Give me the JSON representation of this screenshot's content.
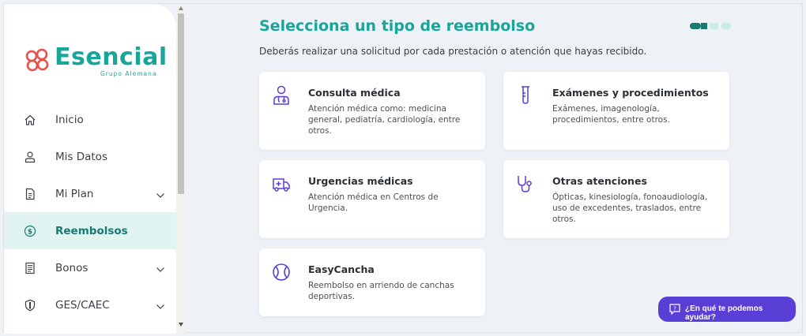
{
  "brand": {
    "name": "Esencial",
    "subtitle": "Grupo Alemana",
    "color": "#1aa59b",
    "mark_color": "#e8504d"
  },
  "sidebar": {
    "items": [
      {
        "label": "Inicio",
        "icon": "home-icon",
        "chevron": false,
        "active": false
      },
      {
        "label": "Mis Datos",
        "icon": "user-icon",
        "chevron": false,
        "active": false
      },
      {
        "label": "Mi Plan",
        "icon": "document-icon",
        "chevron": true,
        "active": false
      },
      {
        "label": "Reembolsos",
        "icon": "dollar-circle-icon",
        "chevron": false,
        "active": true
      },
      {
        "label": "Bonos",
        "icon": "receipt-icon",
        "chevron": true,
        "active": false
      },
      {
        "label": "GES/CAEC",
        "icon": "shield-icon",
        "chevron": true,
        "active": false
      }
    ]
  },
  "main": {
    "title": "Selecciona un tipo de reembolso",
    "subtitle": "Deberás realizar una solicitud por cada prestación o atención que hayas recibido.",
    "stepper": {
      "total": 4,
      "current": 1
    },
    "cards": [
      {
        "title": "Consulta médica",
        "description": "Atención médica como: medicina general, pediatría, cardiología, entre otros.",
        "icon": "doctor-icon"
      },
      {
        "title": "Exámenes y procedimientos",
        "description": "Exámenes, imagenología, procedimientos, entre otros.",
        "icon": "test-tube-icon"
      },
      {
        "title": "Urgencias médicas",
        "description": "Atención médica en Centros de Urgencia.",
        "icon": "ambulance-icon"
      },
      {
        "title": "Otras atenciones",
        "description": "Ópticas, kinesiología, fonoaudiología, uso de excedentes, traslados, entre otros.",
        "icon": "stethoscope-icon"
      },
      {
        "title": "EasyCancha",
        "description": "Reembolso en arriendo de canchas deportivas.",
        "icon": "ball-icon"
      }
    ]
  },
  "help": {
    "label": "¿En qué te podemos ayudar?",
    "icon": "chat-icon",
    "color": "#5a3fd6"
  },
  "colors": {
    "accent": "#1aa59b",
    "active_bg": "#e2f4f1",
    "icon_purple": "#5a3fd6"
  }
}
